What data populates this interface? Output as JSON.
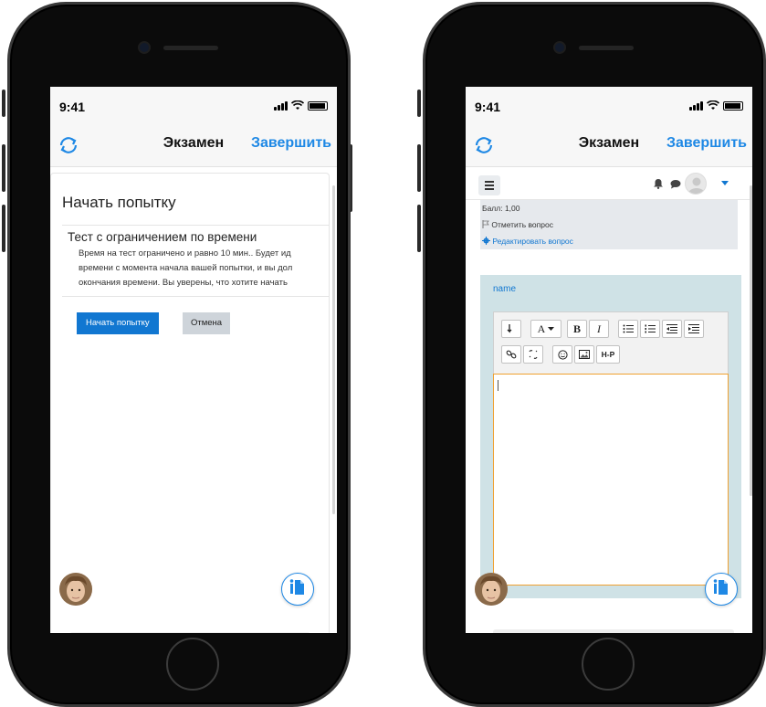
{
  "phones": [
    {
      "status": {
        "time": "9:41"
      },
      "nav": {
        "title": "Экзамен",
        "finish": "Завершить"
      },
      "card": {
        "title": "Начать попытку",
        "quiz_heading": "Тест с ограничением по времени",
        "quiz_text_lines": [
          "Время на тест ограничено и равно 10 мин.. Будет ид",
          "времени с момента начала вашей попытки, и вы дол",
          "окончания времени. Вы уверены, что хотите начать"
        ],
        "start_button": "Начать попытку",
        "cancel_button": "Отмена"
      }
    },
    {
      "status": {
        "time": "9:41"
      },
      "nav": {
        "title": "Экзамен",
        "finish": "Завершить"
      },
      "question": {
        "score": "Балл: 1,00",
        "flag": "Отметить вопрос",
        "edit": "Редактировать вопрос",
        "name": "name",
        "toolbar": [
          "A",
          "B",
          "I",
          "H-P"
        ]
      }
    }
  ],
  "colors": {
    "accent": "#1e88e5",
    "button_primary": "#1177d1",
    "editor_border": "#f0a030",
    "question_bg": "#cfe2e6"
  },
  "icons": [
    "sync-icon",
    "signal-icon",
    "wifi-icon",
    "battery-icon",
    "document-info-icon",
    "hamburger-icon",
    "bell-icon",
    "chat-icon",
    "caret-down-icon"
  ]
}
